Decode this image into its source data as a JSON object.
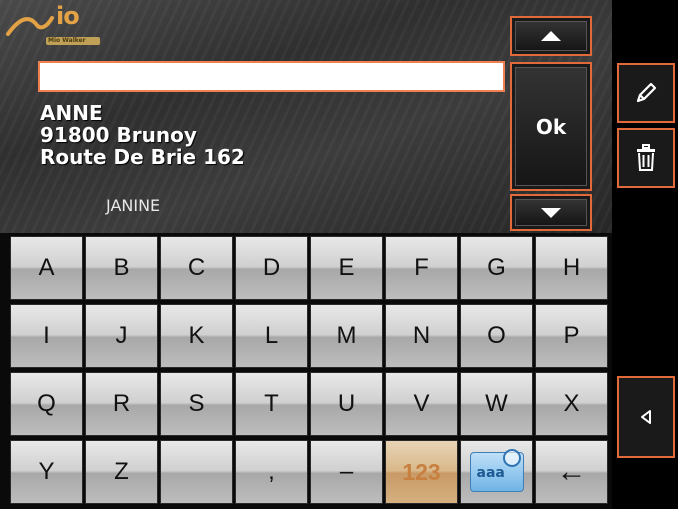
{
  "logo": {
    "text": "io",
    "badge": "Mio Walker"
  },
  "search": {
    "value": "",
    "placeholder": ""
  },
  "result": {
    "name": "ANNE",
    "city": "91800 Brunoy",
    "street": "Route De Brie 162",
    "next_name": "JANINE"
  },
  "controls": {
    "ok_label": "Ok",
    "up_icon": "triangle-up-icon",
    "down_icon": "triangle-down-icon",
    "edit_icon": "pencil-icon",
    "delete_icon": "trash-icon",
    "back_icon": "triangle-left-icon"
  },
  "keyboard": {
    "row1": [
      "A",
      "B",
      "C",
      "D",
      "E",
      "F",
      "G",
      "H"
    ],
    "row2": [
      "I",
      "J",
      "K",
      "L",
      "M",
      "N",
      "O",
      "P"
    ],
    "row3": [
      "Q",
      "R",
      "S",
      "T",
      "U",
      "V",
      "W",
      "X"
    ],
    "row4": [
      "Y",
      "Z",
      "",
      ",",
      "–",
      "123",
      "aaa",
      "←"
    ]
  },
  "colors": {
    "accent": "#e06a3a",
    "panel": "#333333",
    "key_numeric": "#d9b88a",
    "logo": "#e2a245"
  }
}
